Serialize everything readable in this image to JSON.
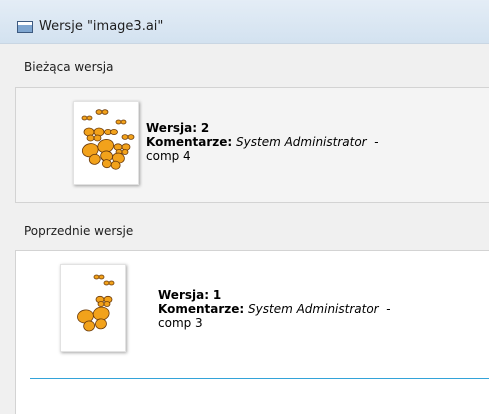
{
  "window": {
    "title": "Wersje \"image3.ai\"",
    "icon": "window-icon"
  },
  "current": {
    "group_label": "Bieżąca wersja",
    "version_label": "Wersja:",
    "version_number": "2",
    "comment_label": "Komentarze:",
    "author": "System Administrator",
    "dash": "-",
    "comment": "comp 4",
    "thumbnail_icon": "butterflies-thumbnail-icon"
  },
  "previous": {
    "group_label": "Poprzednie wersje",
    "items": [
      {
        "version_label": "Wersja:",
        "version_number": "1",
        "comment_label": "Komentarze:",
        "author": "System Administrator",
        "dash": "-",
        "comment": "comp 3",
        "thumbnail_icon": "butterflies-thumbnail-icon"
      }
    ]
  },
  "colors": {
    "butterfly_orange": "#f2a21b",
    "butterfly_dark": "#6b3a0a",
    "separator_blue": "#33a3d9"
  }
}
